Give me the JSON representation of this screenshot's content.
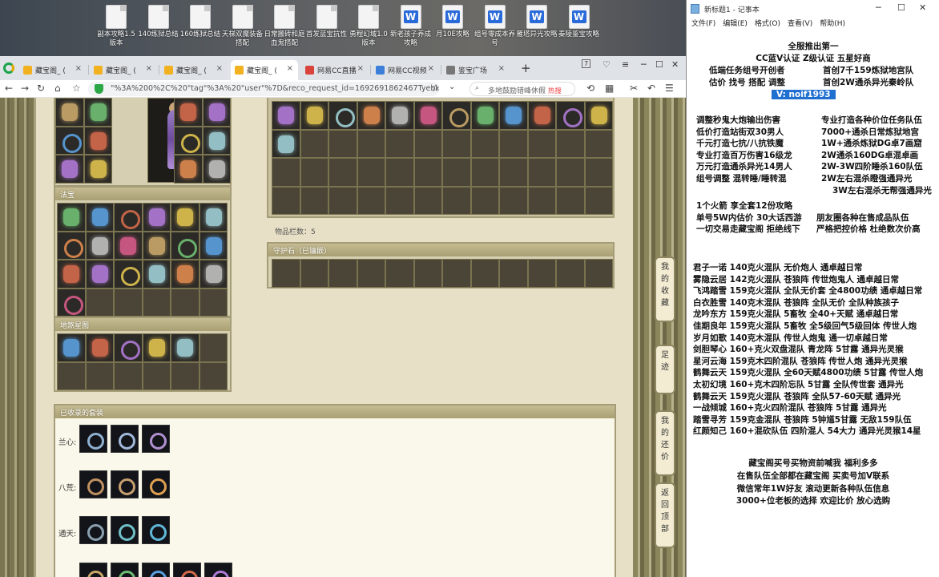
{
  "desktop": {
    "icons": [
      {
        "label": "副本攻略1.5版本",
        "type": "doc"
      },
      {
        "label": "140练狱总结",
        "type": "doc"
      },
      {
        "label": "160练狱总结",
        "type": "doc"
      },
      {
        "label": "天梯双魔装备搭配",
        "type": "doc"
      },
      {
        "label": "日常搬砖和庭血鬼搭配",
        "type": "doc"
      },
      {
        "label": "首发蓝宝抗性",
        "type": "doc"
      },
      {
        "label": "勇程幻域1.0版本",
        "type": "doc"
      },
      {
        "label": "新老孩子养成攻略",
        "type": "wps"
      },
      {
        "label": "月10E攻略",
        "type": "wps"
      },
      {
        "label": "组号零成本养号",
        "type": "wps"
      },
      {
        "label": "雁塔异光攻略",
        "type": "wps"
      },
      {
        "label": "秦陵鉴宝攻略",
        "type": "wps"
      }
    ]
  },
  "browser": {
    "tabs": [
      {
        "label": "藏宝阁_ (",
        "active": false
      },
      {
        "label": "藏宝阁_ (",
        "active": false
      },
      {
        "label": "藏宝阁_ (",
        "active": false
      },
      {
        "label": "藏宝阁_ (",
        "active": true
      },
      {
        "label": "网易CC直播",
        "active": false
      },
      {
        "label": "网易CC视频",
        "active": false
      },
      {
        "label": "鉴宝广场",
        "active": false
      }
    ],
    "tab_count": "7",
    "url": "\"%3A%200%2C%20\"tag\"%3A%20\"user\"%7D&reco_request_id=1692691862467Tyebk",
    "search_placeholder": "多地鼓励错峰休假",
    "search_hot": "热搜"
  },
  "page": {
    "fabao_title": "法宝",
    "lingshou_title": "地煞星图",
    "item_count_label": "物品栏数：5",
    "guardstone_title": "守护石（已镶嵌）",
    "collected_title": "已收录的套装",
    "sets": [
      {
        "name": "兰心:",
        "count": 3
      },
      {
        "name": "八荒:",
        "count": 3
      },
      {
        "name": "通天:",
        "count": 3
      }
    ],
    "side_buttons": [
      "我的收藏",
      "足迹",
      "我的还价",
      "返回顶部"
    ]
  },
  "notepad": {
    "title": "新标题1 - 记事本",
    "menu": [
      "文件(F)",
      "编辑(E)",
      "格式(O)",
      "查看(V)",
      "帮助(H)"
    ],
    "header_lines": [
      {
        "l": "全服推出第一"
      },
      {
        "l": "CC蓝V认证  Z级认证  五星好商"
      },
      {
        "l": "低端任务组号开创者",
        "r": "首创7千159炼狱地宫队"
      },
      {
        "l": "估价 找号 搭配 调整",
        "r": "首创2W通杀异光秦岭队"
      }
    ],
    "contact": "V:  noif1993",
    "services": [
      {
        "l": "调整秒鬼大炮输出伤害",
        "r": "专业打造各种价位任务队伍"
      },
      {
        "l": "低价打造站街双30男人",
        "r": "7000+通杀日常炼狱地宫"
      },
      {
        "l": "千元打造七抗/八抗铁魔",
        "r": "1W+通杀炼狱DG卓7画窟"
      },
      {
        "l": "专业打造百万伤害16级龙",
        "r": "2W通杀160DG卓混卓画"
      },
      {
        "l": "万元打造通杀异光14男人",
        "r": "2W-3W四阶睡杀160队伍"
      },
      {
        "l": "组号调整 混转睡/睡转混",
        "r": "2W左右混杀瞪强通异光"
      },
      {
        "l": "",
        "r": "3W左右混杀无帮强通异光"
      }
    ],
    "promo": [
      {
        "l": "1个火箭 享全套12份攻略"
      },
      {
        "l": "单号5W内估价 30大话西游",
        "r": "朋友圈各种在售成品队伍"
      },
      {
        "l": "一切交易走藏宝阁 拒绝线下",
        "r": "严格把控价格 杜绝数次价高"
      }
    ],
    "listings": [
      "君子一诺 140克火混队 无价炮人 通卓越日常",
      "雾隐云居 142克火混队 苍狼阵 传世炮鬼人 通卓越日常",
      "飞鸿踏雪 159克火混队 全队无价套 全4800功绩 通卓越日常",
      "白衣胜雪 140克木混队 苍狼阵 全队无价 全队种族孩子",
      "龙吟东方 159克火混队 5畜牧 全40+天赋 通卓越日常",
      "佳期良年 159克火混队 5畜牧 全5级回气5级回体 传世人炮",
      "岁月如歌 140克木混队 传世人炮鬼 通一切卓越日常",
      "剑胆琴心 160+克火双盘混队 青龙阵 5甘露 通异光灵猴",
      "星河云海 159克木四阶混队 苍狼阵 传世人炮 通异光灵猴",
      "鹤舞云天 159克火混队 全60天赋4800功绩 5甘露 传世人炮",
      "太初幻境 160+克木四阶忘队 5甘露 全队传世套 通异光",
      "鹤舞云天 159克火混队 苍狼阵 全队57-60天赋 通异光",
      "一战倾城 160+克火四阶混队 苍狼阵 5甘露 通异光",
      "踏雪寻芳 159克金混队 苍狼阵 5钟馗5甘露 无敌159队伍",
      "红颜知己 160+混砍队伍 四阶混人 54大力 通异光灵猴14星"
    ],
    "footer": [
      "藏宝阁买号买物资前喊我 福利多多",
      "在售队伍全部都在藏宝阁 买卖号加V联系",
      "微信常年1W好友 滚动更新各种队伍信息",
      "3000+位老板的选择 欢迎比价 放心选购"
    ]
  },
  "colors": {
    "page_bg": "#e7e0c6",
    "panel_border": "#a59d78",
    "highlight": "#1f6fd1"
  }
}
